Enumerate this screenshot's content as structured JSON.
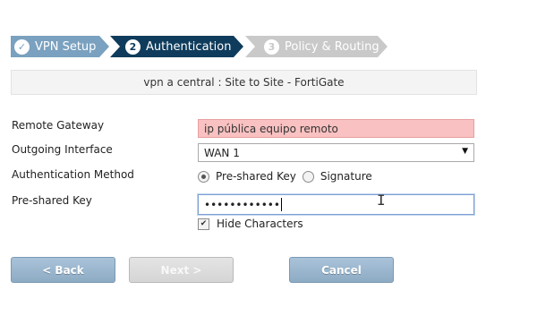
{
  "wizard": {
    "steps": [
      {
        "number": "✓",
        "label": "VPN Setup",
        "state": "done"
      },
      {
        "number": "2",
        "label": "Authentication",
        "state": "active"
      },
      {
        "number": "3",
        "label": "Policy & Routing",
        "state": "pending"
      }
    ]
  },
  "header": {
    "title": "vpn a central : Site to Site - FortiGate"
  },
  "form": {
    "remote_gateway": {
      "label": "Remote Gateway",
      "value": "ip pública equipo remoto"
    },
    "outgoing_interface": {
      "label": "Outgoing Interface",
      "value": "WAN 1"
    },
    "auth_method": {
      "label": "Authentication Method",
      "option1": "Pre-shared Key",
      "option2": "Signature",
      "selected": "Pre-shared Key"
    },
    "psk": {
      "label": "Pre-shared Key",
      "value": "••••••••••••"
    },
    "hide_chars": {
      "label": "Hide Characters",
      "checked": true
    }
  },
  "buttons": {
    "back": "< Back",
    "next": "Next >",
    "cancel": "Cancel"
  },
  "colors": {
    "step_done": "#7aa1bf",
    "step_active": "#0f3c5c",
    "step_pending": "#c9c9c9",
    "error_field": "#f9c1c1",
    "button_blue": "#9bb7cf"
  }
}
